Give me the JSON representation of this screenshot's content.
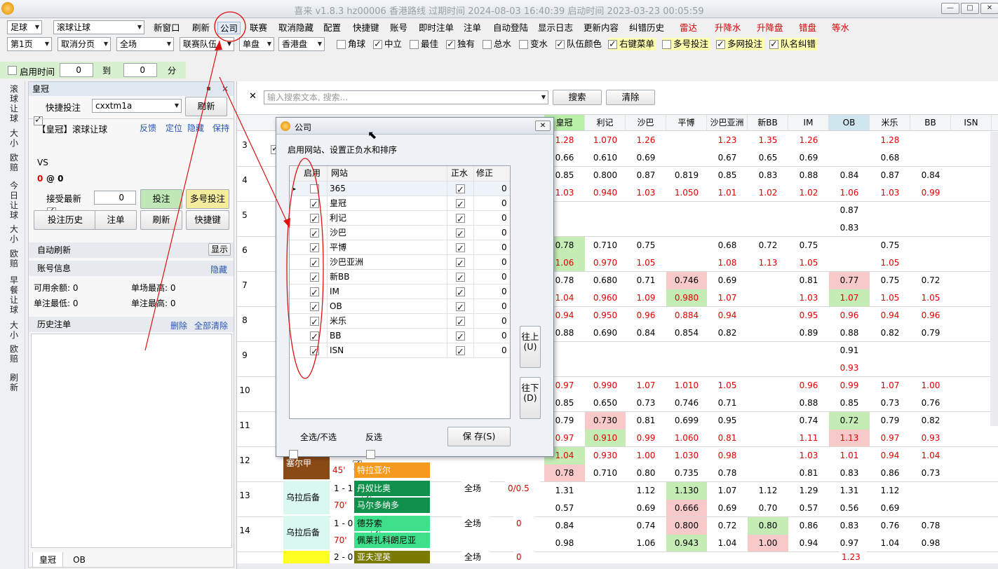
{
  "window": {
    "title": "喜来 v1.8.3 hz00006 香港路线 过期时间 2024-08-03 16:40:39 启动时间 2023-03-23 00:05:59",
    "buttons": [
      "—",
      "□",
      "✕"
    ]
  },
  "toolbar": {
    "sport_select": "足球",
    "market_select": "滚球让球",
    "items": [
      "新窗口",
      "刷新",
      "公司",
      "联赛",
      "取消隐藏",
      "配置",
      "快捷键",
      "账号",
      "即时注单",
      "注单",
      "自动登陆",
      "显示日志",
      "更新内容",
      "纠错历史"
    ],
    "red_items": [
      "雷达",
      "升降水",
      "升降盘",
      "错盘",
      "等水"
    ]
  },
  "toolbar2": {
    "selects": [
      "第1页",
      "取消分页",
      "全场",
      "联赛队伍",
      "单盘",
      "香港盘"
    ],
    "checks": [
      {
        "label": "角球",
        "checked": false
      },
      {
        "label": "中立",
        "checked": true
      },
      {
        "label": "最佳",
        "checked": false
      },
      {
        "label": "独有",
        "checked": true
      },
      {
        "label": "总水",
        "checked": false
      },
      {
        "label": "变水",
        "checked": false
      },
      {
        "label": "队伍颜色",
        "checked": true
      },
      {
        "label": "右键菜单",
        "checked": true
      },
      {
        "label": "多号投注",
        "checked": false
      },
      {
        "label": "多网投注",
        "checked": true
      },
      {
        "label": "队名纠错",
        "checked": true
      }
    ]
  },
  "timer": {
    "label": "启用时间",
    "from": "0",
    "to_label": "到",
    "to": "0",
    "unit": "分"
  },
  "vnav": [
    "滚球让球",
    "大小",
    "欧赔",
    "今日让球",
    "大小",
    "欧赔",
    "早餐让球",
    "大小",
    "欧赔",
    "刷新"
  ],
  "panel": {
    "title": "皇冠",
    "quick_bet_label": "快捷投注",
    "account": "cxxtm1a",
    "refresh": "刷新",
    "market_title": "【皇冠】滚球让球",
    "links": [
      "反馈",
      "定位",
      "隐藏",
      "保持"
    ],
    "vs": "VS",
    "score_red": "0",
    "score_rest": "@ 0",
    "accept_label": "接受最新",
    "amount": "0",
    "bet_btn": "投注",
    "multi_bet_btn": "多号投注",
    "history_btn": "投注历史",
    "order_btn": "注单",
    "refresh_btn": "刷新",
    "shortcut_btn": "快捷键",
    "auto_refresh": "自动刷新",
    "show_btn": "显示",
    "account_info": "账号信息",
    "hide_link": "隐藏",
    "balance": "可用余额: 0",
    "single_max": "单场最高: 0",
    "min_bet": "单注最低: 0",
    "max_bet": "单注最高: 0",
    "history_title": "历史注单",
    "delete": "删除",
    "clear_all": "全部清除",
    "tabs": [
      "皇冠",
      "OB"
    ]
  },
  "search": {
    "placeholder": "输入搜索文本, 搜索...",
    "search_btn": "搜索",
    "clear_btn": "清除"
  },
  "columns": [
    "皇冠",
    "利记",
    "沙巴",
    "平博",
    "沙巴亚洲",
    "新BB",
    "IM",
    "OB",
    "米乐",
    "BB",
    "ISN"
  ],
  "rows": [
    {
      "num": "3",
      "a": [
        "1.28",
        "1.070",
        "1.26",
        "",
        "1.23",
        "1.35",
        "1.26",
        "",
        "1.28",
        "",
        ""
      ],
      "b": [
        "0.66",
        "0.610",
        "0.69",
        "",
        "0.67",
        "0.65",
        "0.69",
        "",
        "0.68",
        "",
        ""
      ]
    },
    {
      "num": "4",
      "a": [
        "0.85",
        "0.800",
        "0.87",
        "0.819",
        "0.85",
        "0.83",
        "0.88",
        "0.84",
        "0.87",
        "0.84",
        ""
      ],
      "b": [
        "1.03",
        "0.940",
        "1.03",
        "1.050",
        "1.01",
        "1.02",
        "1.02",
        "1.06",
        "1.03",
        "0.99",
        ""
      ]
    },
    {
      "num": "5",
      "a": [
        "",
        "",
        "",
        "",
        "",
        "",
        "",
        "0.87",
        "",
        "",
        ""
      ],
      "b": [
        "",
        "",
        "",
        "",
        "",
        "",
        "",
        "0.83",
        "",
        "",
        ""
      ]
    },
    {
      "num": "6",
      "a": [
        "0.78",
        "0.710",
        "0.75",
        "",
        "0.68",
        "0.72",
        "0.75",
        "",
        "0.75",
        "",
        ""
      ],
      "b": [
        "1.06",
        "0.970",
        "1.05",
        "",
        "1.08",
        "1.13",
        "1.05",
        "",
        "1.05",
        "",
        ""
      ]
    },
    {
      "num": "7",
      "a": [
        "0.78",
        "0.680",
        "0.71",
        "0.746",
        "0.69",
        "",
        "0.81",
        "0.77",
        "0.75",
        "0.72",
        ""
      ],
      "b": [
        "1.04",
        "0.960",
        "1.09",
        "0.980",
        "1.07",
        "",
        "1.03",
        "1.07",
        "1.05",
        "1.05",
        ""
      ]
    },
    {
      "num": "8",
      "a": [
        "0.94",
        "0.950",
        "0.96",
        "0.884",
        "0.94",
        "",
        "0.95",
        "0.96",
        "0.94",
        "0.96",
        ""
      ],
      "b": [
        "0.88",
        "0.690",
        "0.84",
        "0.854",
        "0.82",
        "",
        "0.89",
        "0.88",
        "0.82",
        "0.79",
        ""
      ]
    },
    {
      "num": "9",
      "a": [
        "",
        "",
        "",
        "",
        "",
        "",
        "",
        "0.91",
        "",
        "",
        ""
      ],
      "b": [
        "",
        "",
        "",
        "",
        "",
        "",
        "",
        "0.93",
        "",
        "",
        ""
      ]
    },
    {
      "num": "10",
      "a": [
        "0.97",
        "0.990",
        "1.07",
        "1.010",
        "1.05",
        "",
        "0.96",
        "0.99",
        "1.07",
        "1.00",
        ""
      ],
      "b": [
        "0.85",
        "0.650",
        "0.73",
        "0.746",
        "0.71",
        "",
        "0.88",
        "0.85",
        "0.73",
        "0.76",
        ""
      ]
    },
    {
      "num": "11",
      "a": [
        "0.79",
        "0.730",
        "0.81",
        "0.699",
        "0.95",
        "",
        "0.74",
        "0.72",
        "0.79",
        "0.82",
        ""
      ],
      "b": [
        "0.97",
        "0.910",
        "0.99",
        "1.060",
        "0.81",
        "",
        "1.11",
        "1.13",
        "0.97",
        "0.93",
        ""
      ]
    },
    {
      "num": "12",
      "a": [
        "1.04",
        "0.930",
        "1.00",
        "1.030",
        "0.98",
        "",
        "1.03",
        "1.01",
        "0.94",
        "1.04",
        ""
      ],
      "b": [
        "0.78",
        "0.710",
        "0.80",
        "0.735",
        "0.78",
        "",
        "0.81",
        "0.83",
        "0.86",
        "0.73",
        ""
      ]
    },
    {
      "num": "13",
      "a": [
        "1.31",
        "",
        "1.12",
        "1.130",
        "1.07",
        "1.12",
        "1.29",
        "1.31",
        "1.12",
        "",
        ""
      ],
      "b": [
        "0.57",
        "",
        "0.69",
        "0.666",
        "0.69",
        "0.70",
        "0.57",
        "0.56",
        "0.69",
        "",
        ""
      ]
    },
    {
      "num": "14",
      "a": [
        "0.84",
        "",
        "0.74",
        "0.800",
        "0.72",
        "0.80",
        "0.86",
        "0.83",
        "0.76",
        "0.78",
        ""
      ],
      "b": [
        "0.98",
        "",
        "1.06",
        "0.943",
        "1.04",
        "1.00",
        "0.94",
        "0.97",
        "1.04",
        "0.98",
        ""
      ]
    }
  ],
  "matches": [
    {
      "league": "塞尔甲",
      "time": "45'",
      "team2": "特拉亚尔"
    },
    {
      "league": "乌拉后备",
      "score": "1 - 1",
      "time": "70'",
      "team1": "丹奴比奥",
      "team2": "马尔多纳多",
      "scope": "全场",
      "line": "0/0.5"
    },
    {
      "league": "乌拉后备",
      "score": "1 - 0",
      "time": "70'",
      "team1": "德芬索",
      "team2": "佩莱扎科朗尼亚",
      "scope": "全场",
      "line": "0"
    },
    {
      "score": "2 - 0",
      "team1": "亚夫涅英",
      "scope": "全场",
      "line": "0",
      "ob": "1.23"
    }
  ],
  "dialog": {
    "title": "公司",
    "subtitle": "启用网站、设置正负水和排序",
    "headers": [
      "启用",
      "网站",
      "正水",
      "修正"
    ],
    "sites": [
      {
        "name": "365",
        "enabled": false,
        "pos": true,
        "fix": "0"
      },
      {
        "name": "皇冠",
        "enabled": true,
        "pos": true,
        "fix": "0"
      },
      {
        "name": "利记",
        "enabled": true,
        "pos": true,
        "fix": "0"
      },
      {
        "name": "沙巴",
        "enabled": true,
        "pos": true,
        "fix": "0"
      },
      {
        "name": "平博",
        "enabled": true,
        "pos": true,
        "fix": "0"
      },
      {
        "name": "沙巴亚洲",
        "enabled": true,
        "pos": true,
        "fix": "0"
      },
      {
        "name": "新BB",
        "enabled": true,
        "pos": true,
        "fix": "0"
      },
      {
        "name": "IM",
        "enabled": true,
        "pos": true,
        "fix": "0"
      },
      {
        "name": "OB",
        "enabled": true,
        "pos": true,
        "fix": "0"
      },
      {
        "name": "米乐",
        "enabled": true,
        "pos": true,
        "fix": "0"
      },
      {
        "name": "BB",
        "enabled": true,
        "pos": true,
        "fix": "0"
      },
      {
        "name": "ISN",
        "enabled": true,
        "pos": true,
        "fix": "0"
      }
    ],
    "up_btn": "往上(U)",
    "down_btn": "往下(D)",
    "select_all": "全选/不选",
    "invert": "反选",
    "save": "保 存(S)"
  }
}
